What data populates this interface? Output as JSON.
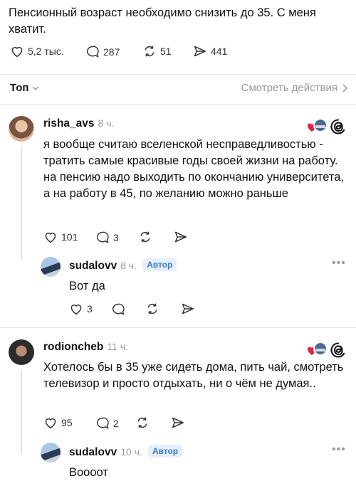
{
  "post": {
    "text": "Пенсионный возраст необходимо снизить до 35. С меня хватит.",
    "likes": "5,2 тыс.",
    "comments": "287",
    "reposts": "51",
    "shares": "441"
  },
  "sort": {
    "label": "Топ",
    "view_activity": "Смотреть действия"
  },
  "replies": [
    {
      "username": "risha_avs",
      "time": "8 ч.",
      "text": "я вообще считаю вселенской несправедливостью - тратить самые красивые годы своей жизни на работу. на пенсию надо выходить по окончанию университета, а на работу в 45, по желанию можно раньше",
      "likes": "101",
      "comments": "3"
    },
    {
      "username": "sudalovv",
      "time": "8 ч.",
      "badge": "Автор",
      "text": "Вот да",
      "likes": "3"
    },
    {
      "username": "rodioncheb",
      "time": "11 ч.",
      "text": "Хотелось бы в 35 уже сидеть дома, пить чай, смотреть телевизор и просто отдыхать, ни о чём не думая..",
      "likes": "95",
      "comments": "2"
    },
    {
      "username": "sudalovv",
      "time": "10 ч.",
      "badge": "Автор",
      "text": "Воооот"
    }
  ],
  "colors": {
    "accent": "#3a7bd5",
    "heart": "#e0244c",
    "divider": "#e4e4e4"
  }
}
